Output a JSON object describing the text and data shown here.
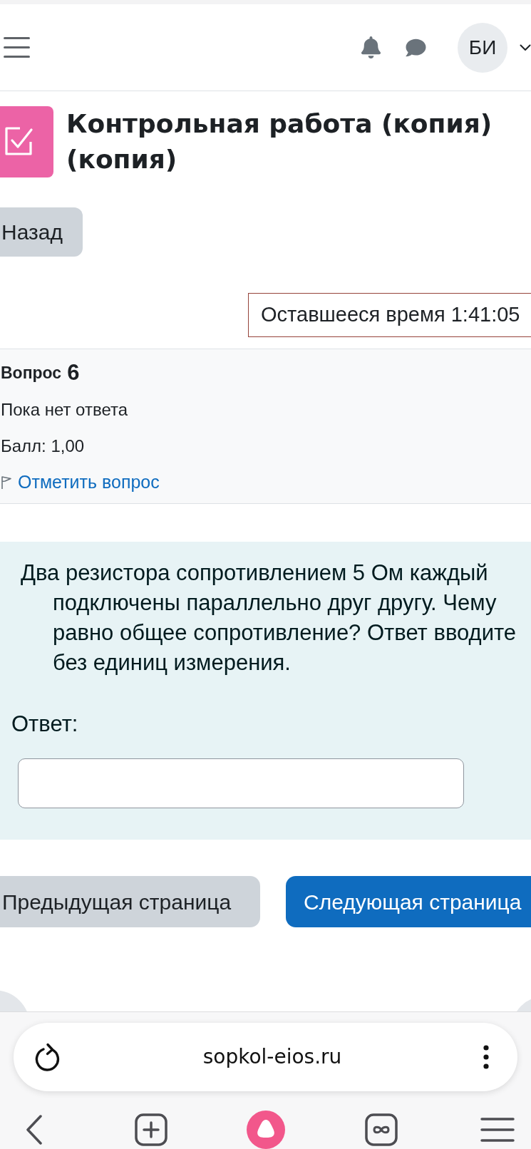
{
  "top_bar": {
    "avatar_initials": "БИ"
  },
  "page": {
    "title": "Контрольная работа (копия) (копия)",
    "back_button": "Назад"
  },
  "timer": {
    "text": "Оставшееся время 1:41:05"
  },
  "question_info": {
    "label": "Вопрос",
    "number": "6",
    "status": "Пока нет ответа",
    "grade": "Балл: 1,00",
    "flag_link": "Отметить вопрос",
    "flagged": false
  },
  "question": {
    "text": "Два резистора сопротивлением 5 Ом каждый подключены параллельно друг другу. Чему равно общее сопротивление? Ответ вводите без единиц измерения.",
    "answer_label": "Ответ:"
  },
  "navigation": [
    {
      "label": "Предыдущая страница",
      "kind": "secondary"
    },
    {
      "label": "Следующая страница",
      "kind": "primary"
    }
  ],
  "browser": {
    "url": "sopkol-eios.ru"
  }
}
